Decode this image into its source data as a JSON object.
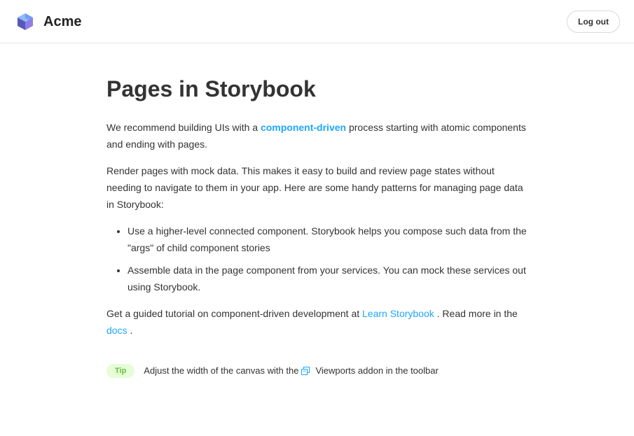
{
  "header": {
    "brand": "Acme",
    "logout_label": "Log out"
  },
  "main": {
    "title": "Pages in Storybook",
    "intro": {
      "before": "We recommend building UIs with a ",
      "link": "component-driven",
      "after": " process starting with atomic components and ending with pages."
    },
    "paragraph2": "Render pages with mock data. This makes it easy to build and review page states without needing to navigate to them in your app. Here are some handy patterns for managing page data in Storybook:",
    "bullets": [
      "Use a higher-level connected component. Storybook helps you compose such data from the \"args\" of child component stories",
      "Assemble data in the page component from your services. You can mock these services out using Storybook."
    ],
    "tutorial": {
      "before": "Get a guided tutorial on component-driven development at ",
      "link": "Learn Storybook",
      "middle": " . Read more in the ",
      "docs_link": "docs",
      "after": " ."
    },
    "tip": {
      "badge": "Tip",
      "before": "Adjust the width of the canvas with the ",
      "after": "Viewports addon in the toolbar"
    }
  },
  "colors": {
    "link": "#1ea7fd",
    "tip_bg": "#e7fdd8",
    "tip_text": "#66bf3c"
  },
  "icons": {
    "logo": "storybook-cube-icon",
    "viewport": "viewport-icon"
  }
}
